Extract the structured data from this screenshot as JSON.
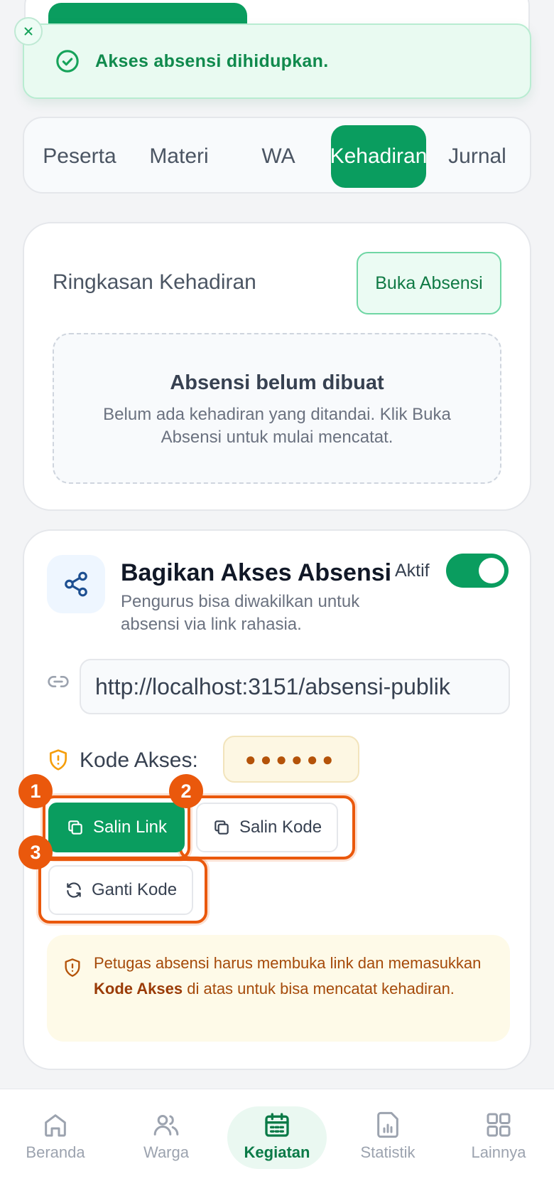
{
  "toast": {
    "message": "Akses absensi dihidupkan.",
    "icons": {
      "close": "close-icon",
      "status": "check-circle-icon"
    }
  },
  "tabs": [
    {
      "label": "Peserta",
      "active": false
    },
    {
      "label": "Materi",
      "active": false
    },
    {
      "label": "WA",
      "active": false
    },
    {
      "label": "Kehadiran",
      "active": true
    },
    {
      "label": "Jurnal",
      "active": false
    }
  ],
  "summary": {
    "title": "Ringkasan Kehadiran",
    "open_button": "Buka Absensi",
    "empty_title": "Absensi belum dibuat",
    "empty_desc": "Belum ada kehadiran yang ditandai. Klik Buka Absensi untuk mulai mencatat."
  },
  "share": {
    "title": "Bagikan Akses Absensi",
    "desc": "Pengurus bisa diwakilkan untuk absensi via link rahasia.",
    "toggle_label": "Aktif",
    "toggle_on": true,
    "url": "http://localhost:3151/absensi-publik",
    "code_label": "Kode Akses:",
    "code_masked": "●●●●●●",
    "buttons": {
      "copy_link": "Salin Link",
      "copy_code": "Salin Kode",
      "change_code": "Ganti Kode"
    },
    "badges": [
      "1",
      "2",
      "3"
    ],
    "info_pre": "Petugas absensi harus membuka link dan memasukkan ",
    "info_bold": "Kode Akses",
    "info_post": " di atas untuk bisa mencatat kehadiran."
  },
  "bottom_nav": [
    {
      "label": "Beranda",
      "icon": "home-icon",
      "active": false
    },
    {
      "label": "Warga",
      "icon": "users-icon",
      "active": false
    },
    {
      "label": "Kegiatan",
      "icon": "calendar-icon",
      "active": true
    },
    {
      "label": "Statistik",
      "icon": "chart-file-icon",
      "active": false
    },
    {
      "label": "Lainnya",
      "icon": "grid-icon",
      "active": false
    }
  ],
  "colors": {
    "primary": "#0a9d5f",
    "highlight": "#ea580c",
    "warning_bg": "#fefae8",
    "toast_bg": "#e9faf1"
  }
}
